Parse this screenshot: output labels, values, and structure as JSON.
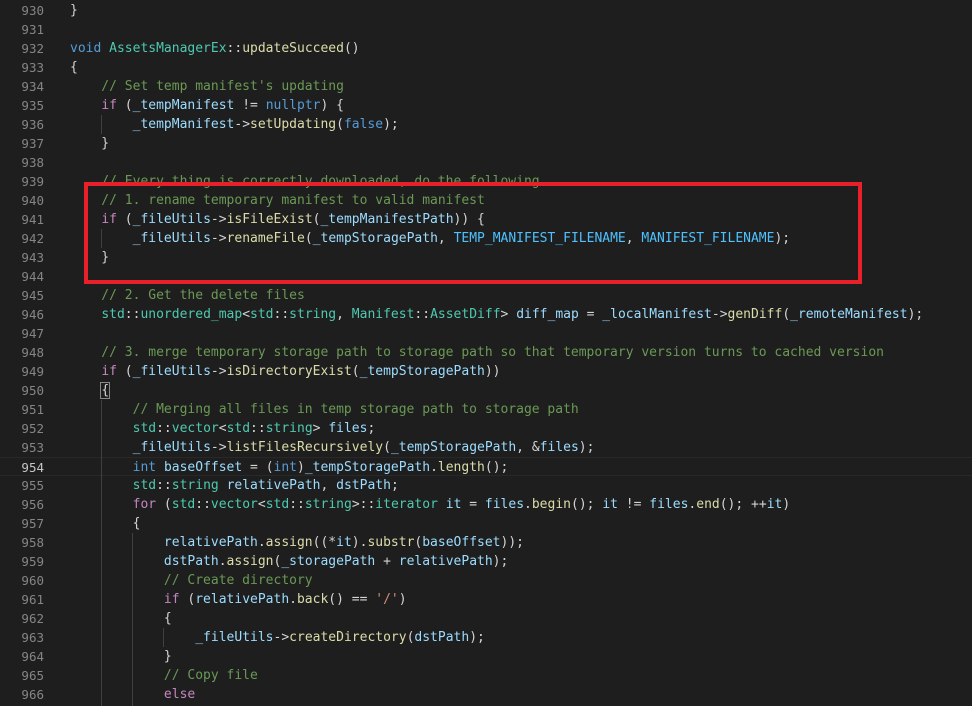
{
  "editor": {
    "lines": [
      {
        "num": "930",
        "tokens": [
          {
            "t": "}",
            "c": "pl"
          }
        ]
      },
      {
        "num": "931",
        "tokens": []
      },
      {
        "num": "932",
        "tokens": [
          {
            "t": "void ",
            "c": "kw"
          },
          {
            "t": "AssetsManagerEx",
            "c": "ty"
          },
          {
            "t": "::",
            "c": "pl"
          },
          {
            "t": "updateSucceed",
            "c": "fn"
          },
          {
            "t": "()",
            "c": "pl"
          }
        ]
      },
      {
        "num": "933",
        "tokens": [
          {
            "t": "{",
            "c": "pl"
          }
        ]
      },
      {
        "num": "934",
        "tokens": [
          {
            "t": "    // Set temp manifest's updating",
            "c": "cm"
          }
        ]
      },
      {
        "num": "935",
        "tokens": [
          {
            "t": "    ",
            "c": "pl"
          },
          {
            "t": "if",
            "c": "ctl"
          },
          {
            "t": " (",
            "c": "pl"
          },
          {
            "t": "_tempManifest",
            "c": "vr"
          },
          {
            "t": " != ",
            "c": "pl"
          },
          {
            "t": "nullptr",
            "c": "kw"
          },
          {
            "t": ") {",
            "c": "pl"
          }
        ]
      },
      {
        "num": "936",
        "tokens": [
          {
            "t": "        ",
            "c": "pl"
          },
          {
            "t": "_tempManifest",
            "c": "vr"
          },
          {
            "t": "->",
            "c": "pl"
          },
          {
            "t": "setUpdating",
            "c": "fn"
          },
          {
            "t": "(",
            "c": "pl"
          },
          {
            "t": "false",
            "c": "kw"
          },
          {
            "t": ");",
            "c": "pl"
          }
        ]
      },
      {
        "num": "937",
        "tokens": [
          {
            "t": "    }",
            "c": "pl"
          }
        ]
      },
      {
        "num": "938",
        "tokens": []
      },
      {
        "num": "939",
        "tokens": [
          {
            "t": "    // Every thing is correctly downloaded, do the following",
            "c": "cm"
          }
        ]
      },
      {
        "num": "940",
        "tokens": [
          {
            "t": "    // 1. rename temporary manifest to valid manifest",
            "c": "cm"
          }
        ]
      },
      {
        "num": "941",
        "tokens": [
          {
            "t": "    ",
            "c": "pl"
          },
          {
            "t": "if",
            "c": "ctl"
          },
          {
            "t": " (",
            "c": "pl"
          },
          {
            "t": "_fileUtils",
            "c": "vr"
          },
          {
            "t": "->",
            "c": "pl"
          },
          {
            "t": "isFileExist",
            "c": "fn"
          },
          {
            "t": "(",
            "c": "pl"
          },
          {
            "t": "_tempManifestPath",
            "c": "vr"
          },
          {
            "t": ")) {",
            "c": "pl"
          }
        ]
      },
      {
        "num": "942",
        "tokens": [
          {
            "t": "        ",
            "c": "pl"
          },
          {
            "t": "_fileUtils",
            "c": "vr"
          },
          {
            "t": "->",
            "c": "pl"
          },
          {
            "t": "renameFile",
            "c": "fn"
          },
          {
            "t": "(",
            "c": "pl"
          },
          {
            "t": "_tempStoragePath",
            "c": "vr"
          },
          {
            "t": ", ",
            "c": "pl"
          },
          {
            "t": "TEMP_MANIFEST_FILENAME",
            "c": "mc"
          },
          {
            "t": ", ",
            "c": "pl"
          },
          {
            "t": "MANIFEST_FILENAME",
            "c": "mc"
          },
          {
            "t": ");",
            "c": "pl"
          }
        ]
      },
      {
        "num": "943",
        "tokens": [
          {
            "t": "    }",
            "c": "pl"
          }
        ]
      },
      {
        "num": "944",
        "tokens": []
      },
      {
        "num": "945",
        "tokens": [
          {
            "t": "    // 2. Get the delete files",
            "c": "cm"
          }
        ]
      },
      {
        "num": "946",
        "tokens": [
          {
            "t": "    ",
            "c": "pl"
          },
          {
            "t": "std",
            "c": "ty"
          },
          {
            "t": "::",
            "c": "pl"
          },
          {
            "t": "unordered_map",
            "c": "ty"
          },
          {
            "t": "<",
            "c": "pl"
          },
          {
            "t": "std",
            "c": "ty"
          },
          {
            "t": "::",
            "c": "pl"
          },
          {
            "t": "string",
            "c": "ty"
          },
          {
            "t": ", ",
            "c": "pl"
          },
          {
            "t": "Manifest",
            "c": "ty"
          },
          {
            "t": "::",
            "c": "pl"
          },
          {
            "t": "AssetDiff",
            "c": "ty"
          },
          {
            "t": "> ",
            "c": "pl"
          },
          {
            "t": "diff_map",
            "c": "vr"
          },
          {
            "t": " = ",
            "c": "pl"
          },
          {
            "t": "_localManifest",
            "c": "vr"
          },
          {
            "t": "->",
            "c": "pl"
          },
          {
            "t": "genDiff",
            "c": "fn"
          },
          {
            "t": "(",
            "c": "pl"
          },
          {
            "t": "_remoteManifest",
            "c": "vr"
          },
          {
            "t": ");",
            "c": "pl"
          }
        ]
      },
      {
        "num": "947",
        "tokens": []
      },
      {
        "num": "948",
        "tokens": [
          {
            "t": "    // 3. merge temporary storage path to storage path so that temporary version turns to cached version",
            "c": "cm"
          }
        ]
      },
      {
        "num": "949",
        "tokens": [
          {
            "t": "    ",
            "c": "pl"
          },
          {
            "t": "if",
            "c": "ctl"
          },
          {
            "t": " (",
            "c": "pl"
          },
          {
            "t": "_fileUtils",
            "c": "vr"
          },
          {
            "t": "->",
            "c": "pl"
          },
          {
            "t": "isDirectoryExist",
            "c": "fn"
          },
          {
            "t": "(",
            "c": "pl"
          },
          {
            "t": "_tempStoragePath",
            "c": "vr"
          },
          {
            "t": "))",
            "c": "pl"
          }
        ]
      },
      {
        "num": "950",
        "tokens": [
          {
            "t": "    ",
            "c": "pl"
          },
          {
            "t": "{",
            "c": "pl bracket-box"
          }
        ]
      },
      {
        "num": "951",
        "tokens": [
          {
            "t": "        // Merging all files in temp storage path to storage path",
            "c": "cm"
          }
        ]
      },
      {
        "num": "952",
        "tokens": [
          {
            "t": "        ",
            "c": "pl"
          },
          {
            "t": "std",
            "c": "ty"
          },
          {
            "t": "::",
            "c": "pl"
          },
          {
            "t": "vector",
            "c": "ty"
          },
          {
            "t": "<",
            "c": "pl"
          },
          {
            "t": "std",
            "c": "ty"
          },
          {
            "t": "::",
            "c": "pl"
          },
          {
            "t": "string",
            "c": "ty"
          },
          {
            "t": "> ",
            "c": "pl"
          },
          {
            "t": "files",
            "c": "vr"
          },
          {
            "t": ";",
            "c": "pl"
          }
        ]
      },
      {
        "num": "953",
        "tokens": [
          {
            "t": "        ",
            "c": "pl"
          },
          {
            "t": "_fileUtils",
            "c": "vr"
          },
          {
            "t": "->",
            "c": "pl"
          },
          {
            "t": "listFilesRecursively",
            "c": "fn"
          },
          {
            "t": "(",
            "c": "pl"
          },
          {
            "t": "_tempStoragePath",
            "c": "vr"
          },
          {
            "t": ", &",
            "c": "pl"
          },
          {
            "t": "files",
            "c": "vr"
          },
          {
            "t": ");",
            "c": "pl"
          }
        ]
      },
      {
        "num": "954",
        "current": true,
        "tokens": [
          {
            "t": "        ",
            "c": "pl"
          },
          {
            "t": "int",
            "c": "kw"
          },
          {
            "t": " ",
            "c": "pl"
          },
          {
            "t": "baseOffset",
            "c": "vr"
          },
          {
            "t": " = (",
            "c": "pl"
          },
          {
            "t": "int",
            "c": "kw"
          },
          {
            "t": ")",
            "c": "pl"
          },
          {
            "t": "_tempStoragePath",
            "c": "vr"
          },
          {
            "t": ".",
            "c": "pl"
          },
          {
            "t": "length",
            "c": "fn"
          },
          {
            "t": "();",
            "c": "pl"
          }
        ]
      },
      {
        "num": "955",
        "tokens": [
          {
            "t": "        ",
            "c": "pl"
          },
          {
            "t": "std",
            "c": "ty"
          },
          {
            "t": "::",
            "c": "pl"
          },
          {
            "t": "string",
            "c": "ty"
          },
          {
            "t": " ",
            "c": "pl"
          },
          {
            "t": "relativePath",
            "c": "vr"
          },
          {
            "t": ", ",
            "c": "pl"
          },
          {
            "t": "dstPath",
            "c": "vr"
          },
          {
            "t": ";",
            "c": "pl"
          }
        ]
      },
      {
        "num": "956",
        "tokens": [
          {
            "t": "        ",
            "c": "pl"
          },
          {
            "t": "for",
            "c": "ctl"
          },
          {
            "t": " (",
            "c": "pl"
          },
          {
            "t": "std",
            "c": "ty"
          },
          {
            "t": "::",
            "c": "pl"
          },
          {
            "t": "vector",
            "c": "ty"
          },
          {
            "t": "<",
            "c": "pl"
          },
          {
            "t": "std",
            "c": "ty"
          },
          {
            "t": "::",
            "c": "pl"
          },
          {
            "t": "string",
            "c": "ty"
          },
          {
            "t": ">::",
            "c": "pl"
          },
          {
            "t": "iterator",
            "c": "ty"
          },
          {
            "t": " ",
            "c": "pl"
          },
          {
            "t": "it",
            "c": "vr"
          },
          {
            "t": " = ",
            "c": "pl"
          },
          {
            "t": "files",
            "c": "vr"
          },
          {
            "t": ".",
            "c": "pl"
          },
          {
            "t": "begin",
            "c": "fn"
          },
          {
            "t": "(); ",
            "c": "pl"
          },
          {
            "t": "it",
            "c": "vr"
          },
          {
            "t": " != ",
            "c": "pl"
          },
          {
            "t": "files",
            "c": "vr"
          },
          {
            "t": ".",
            "c": "pl"
          },
          {
            "t": "end",
            "c": "fn"
          },
          {
            "t": "(); ++",
            "c": "pl"
          },
          {
            "t": "it",
            "c": "vr"
          },
          {
            "t": ")",
            "c": "pl"
          }
        ]
      },
      {
        "num": "957",
        "tokens": [
          {
            "t": "        {",
            "c": "pl"
          }
        ]
      },
      {
        "num": "958",
        "tokens": [
          {
            "t": "            ",
            "c": "pl"
          },
          {
            "t": "relativePath",
            "c": "vr"
          },
          {
            "t": ".",
            "c": "pl"
          },
          {
            "t": "assign",
            "c": "fn"
          },
          {
            "t": "((*",
            "c": "pl"
          },
          {
            "t": "it",
            "c": "vr"
          },
          {
            "t": ").",
            "c": "pl"
          },
          {
            "t": "substr",
            "c": "fn"
          },
          {
            "t": "(",
            "c": "pl"
          },
          {
            "t": "baseOffset",
            "c": "vr"
          },
          {
            "t": "));",
            "c": "pl"
          }
        ]
      },
      {
        "num": "959",
        "tokens": [
          {
            "t": "            ",
            "c": "pl"
          },
          {
            "t": "dstPath",
            "c": "vr"
          },
          {
            "t": ".",
            "c": "pl"
          },
          {
            "t": "assign",
            "c": "fn"
          },
          {
            "t": "(",
            "c": "pl"
          },
          {
            "t": "_storagePath",
            "c": "vr"
          },
          {
            "t": " + ",
            "c": "pl"
          },
          {
            "t": "relativePath",
            "c": "vr"
          },
          {
            "t": ");",
            "c": "pl"
          }
        ]
      },
      {
        "num": "960",
        "tokens": [
          {
            "t": "            // Create directory",
            "c": "cm"
          }
        ]
      },
      {
        "num": "961",
        "tokens": [
          {
            "t": "            ",
            "c": "pl"
          },
          {
            "t": "if",
            "c": "ctl"
          },
          {
            "t": " (",
            "c": "pl"
          },
          {
            "t": "relativePath",
            "c": "vr"
          },
          {
            "t": ".",
            "c": "pl"
          },
          {
            "t": "back",
            "c": "fn"
          },
          {
            "t": "() == ",
            "c": "pl"
          },
          {
            "t": "'/'",
            "c": "st"
          },
          {
            "t": ")",
            "c": "pl"
          }
        ]
      },
      {
        "num": "962",
        "tokens": [
          {
            "t": "            {",
            "c": "pl"
          }
        ]
      },
      {
        "num": "963",
        "tokens": [
          {
            "t": "                ",
            "c": "pl"
          },
          {
            "t": "_fileUtils",
            "c": "vr"
          },
          {
            "t": "->",
            "c": "pl"
          },
          {
            "t": "createDirectory",
            "c": "fn"
          },
          {
            "t": "(",
            "c": "pl"
          },
          {
            "t": "dstPath",
            "c": "vr"
          },
          {
            "t": ");",
            "c": "pl"
          }
        ]
      },
      {
        "num": "964",
        "tokens": [
          {
            "t": "            }",
            "c": "pl"
          }
        ]
      },
      {
        "num": "965",
        "tokens": [
          {
            "t": "            // Copy file",
            "c": "cm"
          }
        ]
      },
      {
        "num": "966",
        "tokens": [
          {
            "t": "            ",
            "c": "pl"
          },
          {
            "t": "else",
            "c": "ctl"
          }
        ]
      }
    ]
  },
  "colors": {
    "background": "#1e1e1e",
    "highlight_box": "#e8202a",
    "line_number": "#858585",
    "line_number_active": "#c6c6c6"
  }
}
